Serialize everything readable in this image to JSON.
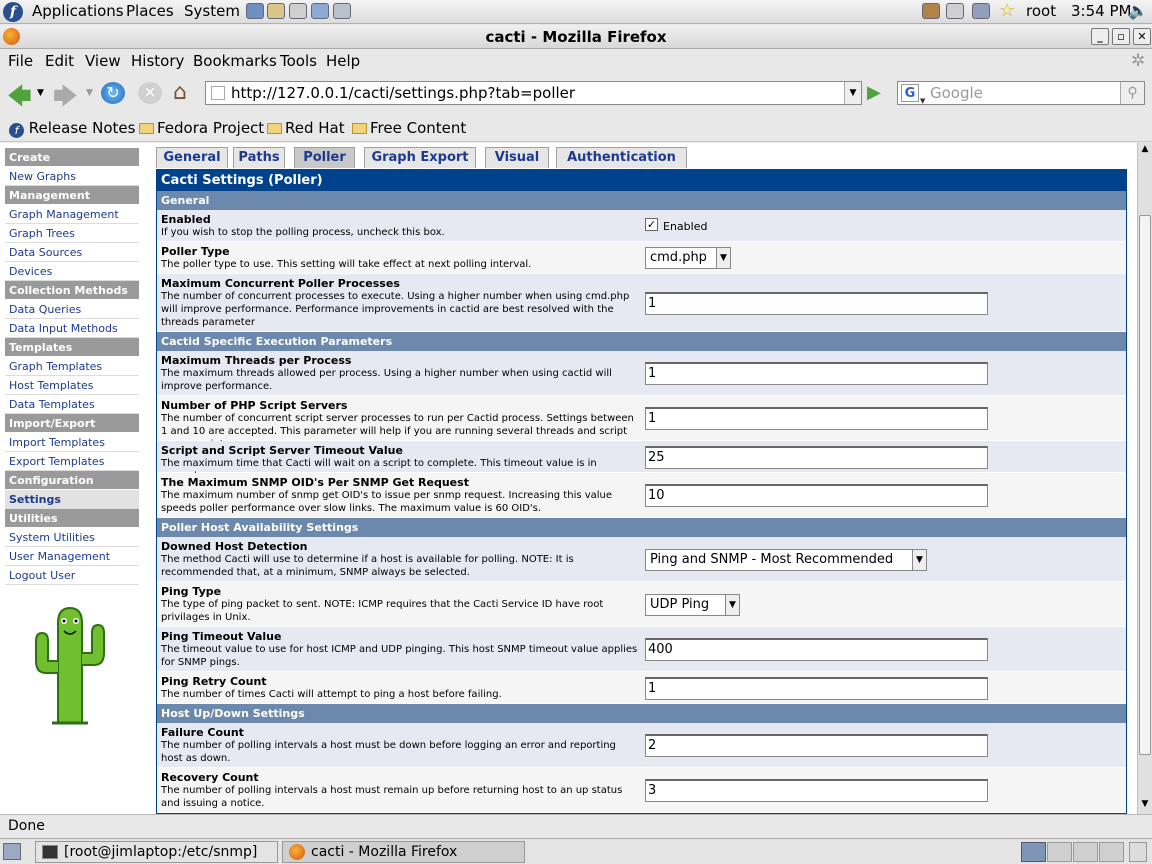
{
  "panel": {
    "applications": "Applications",
    "places": "Places",
    "system": "System",
    "user": "root",
    "clock": "3:54 PM"
  },
  "window": {
    "title": "cacti - Mozilla Firefox"
  },
  "menu": {
    "file": "File",
    "edit": "Edit",
    "view": "View",
    "history": "History",
    "bookmarks": "Bookmarks",
    "tools": "Tools",
    "help": "Help"
  },
  "nav": {
    "url": "http://127.0.0.1/cacti/settings.php?tab=poller",
    "search_placeholder": "Google"
  },
  "bookmarks": [
    "Release Notes",
    "Fedora Project",
    "Red Hat",
    "Free Content"
  ],
  "sidebar": [
    {
      "type": "head",
      "label": "Create"
    },
    {
      "type": "item",
      "label": "New Graphs"
    },
    {
      "type": "head",
      "label": "Management"
    },
    {
      "type": "item",
      "label": "Graph Management"
    },
    {
      "type": "item",
      "label": "Graph Trees"
    },
    {
      "type": "item",
      "label": "Data Sources"
    },
    {
      "type": "item",
      "label": "Devices"
    },
    {
      "type": "head",
      "label": "Collection Methods"
    },
    {
      "type": "item",
      "label": "Data Queries"
    },
    {
      "type": "item",
      "label": "Data Input Methods"
    },
    {
      "type": "head",
      "label": "Templates"
    },
    {
      "type": "item",
      "label": "Graph Templates"
    },
    {
      "type": "item",
      "label": "Host Templates"
    },
    {
      "type": "item",
      "label": "Data Templates"
    },
    {
      "type": "head",
      "label": "Import/Export"
    },
    {
      "type": "item",
      "label": "Import Templates"
    },
    {
      "type": "item",
      "label": "Export Templates"
    },
    {
      "type": "head",
      "label": "Configuration"
    },
    {
      "type": "item",
      "label": "Settings",
      "selected": true
    },
    {
      "type": "head",
      "label": "Utilities"
    },
    {
      "type": "item",
      "label": "System Utilities"
    },
    {
      "type": "item",
      "label": "User Management"
    },
    {
      "type": "item",
      "label": "Logout User"
    }
  ],
  "tabs": [
    {
      "label": "General"
    },
    {
      "label": "Paths"
    },
    {
      "label": "Poller",
      "selected": true
    },
    {
      "label": "Graph Export"
    },
    {
      "label": "Visual"
    },
    {
      "label": "Authentication"
    }
  ],
  "settings_title": "Cacti Settings (Poller)",
  "sections": [
    {
      "title": "General",
      "rows": [
        {
          "title": "Enabled",
          "desc": "If you wish to stop the polling process, uncheck this box.",
          "type": "checkbox",
          "checked": true,
          "value": "Enabled"
        },
        {
          "title": "Poller Type",
          "desc": "The poller type to use. This setting will take effect at next polling interval.",
          "type": "select",
          "value": "cmd.php"
        },
        {
          "title": "Maximum Concurrent Poller Processes",
          "desc": "The number of concurrent processes to execute. Using a higher number when using cmd.php will improve performance. Performance improvements in cactid are best resolved with the threads parameter",
          "type": "text",
          "value": "1"
        }
      ]
    },
    {
      "title": "Cactid Specific Execution Parameters",
      "rows": [
        {
          "title": "Maximum Threads per Process",
          "desc": "The maximum threads allowed per process. Using a higher number when using cactid will improve performance.",
          "type": "text",
          "value": "1"
        },
        {
          "title": "Number of PHP Script Servers",
          "desc": "The number of concurrent script server processes to run per Cactid process. Settings between 1 and 10 are accepted. This parameter will help if you are running several threads and script server scripts.",
          "type": "text",
          "value": "1"
        },
        {
          "title": "Script and Script Server Timeout Value",
          "desc": "The maximum time that Cacti will wait on a script to complete. This timeout value is in seconds",
          "type": "text",
          "value": "25"
        },
        {
          "title": "The Maximum SNMP OID's Per SNMP Get Request",
          "desc": "The maximum number of snmp get OID's to issue per snmp request. Increasing this value speeds poller performance over slow links. The maximum value is 60 OID's.",
          "type": "text",
          "value": "10"
        }
      ]
    },
    {
      "title": "Poller Host Availability Settings",
      "rows": [
        {
          "title": "Downed Host Detection",
          "desc": "The method Cacti will use to determine if a host is available for polling. NOTE: It is recommended that, at a minimum, SNMP always be selected.",
          "type": "select",
          "value": "Ping and SNMP - Most Recommended"
        },
        {
          "title": "Ping Type",
          "desc": "The type of ping packet to sent. NOTE: ICMP requires that the Cacti Service ID have root privilages in Unix.",
          "type": "select",
          "value": "UDP Ping"
        },
        {
          "title": "Ping Timeout Value",
          "desc": "The timeout value to use for host ICMP and UDP pinging. This host SNMP timeout value applies for SNMP pings.",
          "type": "text",
          "value": "400"
        },
        {
          "title": "Ping Retry Count",
          "desc": "The number of times Cacti will attempt to ping a host before failing.",
          "type": "text",
          "value": "1"
        }
      ]
    },
    {
      "title": "Host Up/Down Settings",
      "rows": [
        {
          "title": "Failure Count",
          "desc": "The number of polling intervals a host must be down before logging an error and reporting host as down.",
          "type": "text",
          "value": "2"
        },
        {
          "title": "Recovery Count",
          "desc": "The number of polling intervals a host must remain up before returning host to an up status and issuing a notice.",
          "type": "text",
          "value": "3"
        }
      ]
    }
  ],
  "status": "Done",
  "taskbar": [
    "[root@jimlaptop:/etc/snmp]",
    "cacti - Mozilla Firefox"
  ]
}
